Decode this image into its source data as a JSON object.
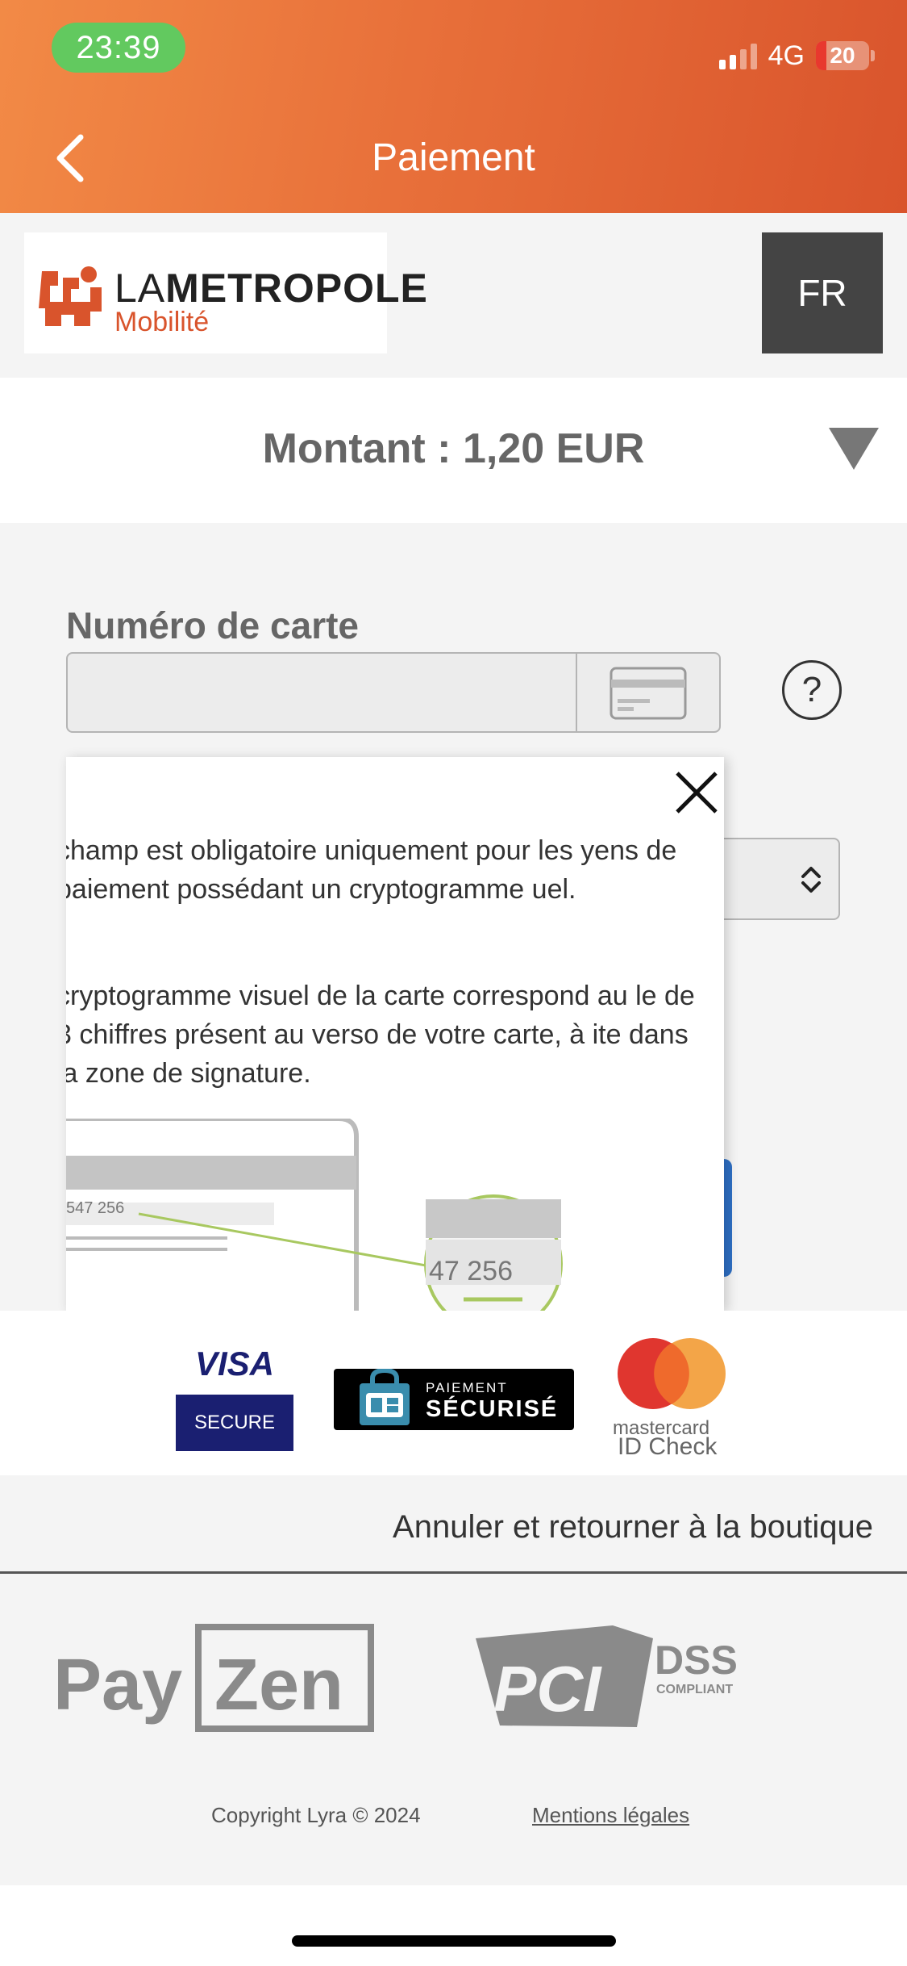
{
  "status_bar": {
    "time": "23:39",
    "network": "4G",
    "battery": "20"
  },
  "header": {
    "title": "Paiement"
  },
  "merchant": {
    "logo_line1_light": "LA",
    "logo_line1_bold": "METROPOLE",
    "logo_line2": "Mobilité",
    "language": "FR"
  },
  "amount": {
    "text": "Montant : 1,20 EUR"
  },
  "form": {
    "card_number_label": "Numéro de carte",
    "card_number_value": "",
    "help_label": "?"
  },
  "tooltip": {
    "paragraph1": "champ est obligatoire uniquement pour les yens de paiement possédant un cryptogramme uel.",
    "paragraph2": "cryptogramme visuel de la carte correspond au le de 3 chiffres présent au verso de votre carte, à ite dans la zone de signature.",
    "card_number_small": "547 256",
    "card_number_zoom": "47 256"
  },
  "payment_logos": {
    "visa_word": "VISA",
    "visa_secure": "SECURE",
    "cb_small": "PAIEMENT",
    "cb_big": "SÉCURISÉ",
    "mastercard_word": "mastercard",
    "mastercard_id": "ID Check"
  },
  "cancel": {
    "label": "Annuler et retourner à la boutique"
  },
  "footer": {
    "payzen_pay": "Pay",
    "payzen_zen": "Zen",
    "pci_text": "PCI",
    "dss_text": "DSS",
    "dss_sub": "COMPLIANT",
    "copyright": "Copyright Lyra © 2024",
    "mentions": "Mentions légales"
  },
  "colors": {
    "header_start": "#f28a46",
    "header_end": "#d9542c",
    "time_pill": "#62c95f",
    "visa_blue": "#1a1f71",
    "button_blue": "#2e6fc4"
  }
}
